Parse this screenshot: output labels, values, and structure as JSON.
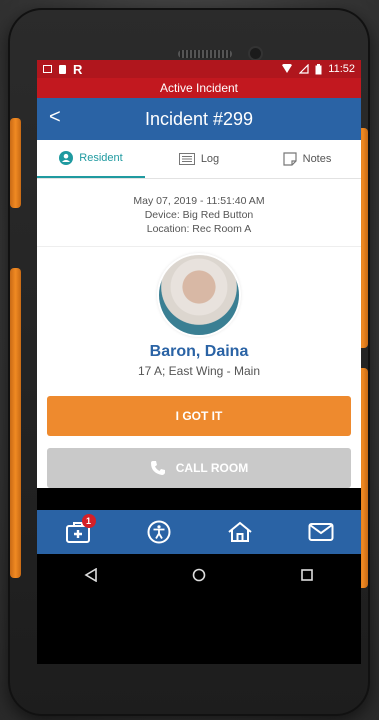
{
  "status_bar": {
    "logo": "R",
    "time": "11:52"
  },
  "banner": {
    "text": "Active Incident"
  },
  "header": {
    "title": "Incident #299",
    "back_symbol": "<"
  },
  "tabs": [
    {
      "label": "Resident"
    },
    {
      "label": "Log"
    },
    {
      "label": "Notes"
    }
  ],
  "incident": {
    "datetime": "May 07, 2019 - 11:51:40 AM",
    "device": "Device: Big Red Button",
    "location": "Location: Rec Room A"
  },
  "resident": {
    "name": "Baron, Daina",
    "room": "17 A; East Wing - Main"
  },
  "buttons": {
    "got_it": "I GOT IT",
    "call_room": "CALL ROOM"
  },
  "bottom_nav": {
    "badge_count": "1",
    "items": [
      "incidents-icon",
      "accessibility-icon",
      "home-icon",
      "mail-icon"
    ]
  },
  "colors": {
    "status_red": "#b0161d",
    "header_blue": "#2a63a5",
    "tab_active": "#1f9aa0",
    "primary_orange": "#ee8a2e",
    "disabled_grey": "#c9c9c9"
  }
}
